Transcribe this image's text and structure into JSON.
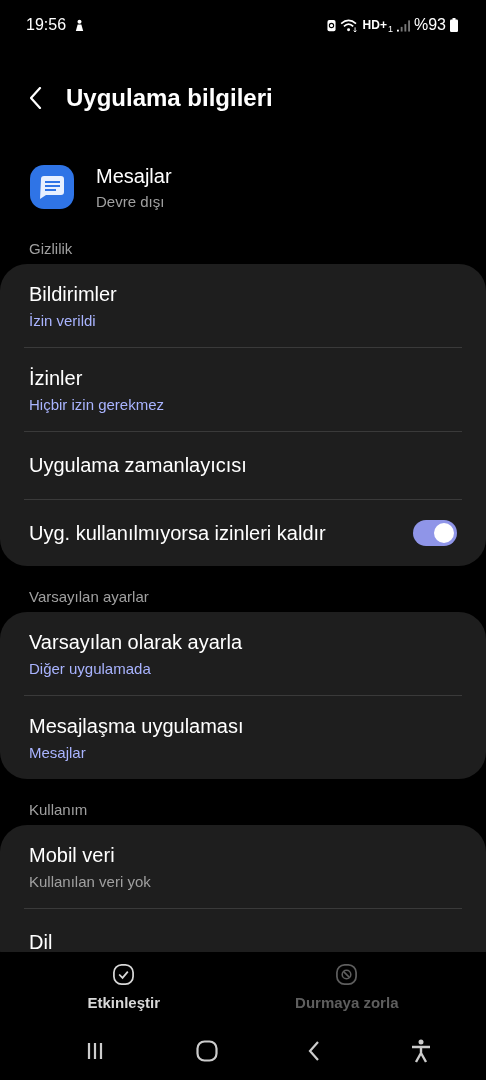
{
  "status_bar": {
    "time": "19:56",
    "network_label": "HD+",
    "sim_label": "1",
    "battery": "%93"
  },
  "header": {
    "title": "Uygulama bilgileri"
  },
  "app": {
    "name": "Mesajlar",
    "status": "Devre dışı"
  },
  "sections": [
    {
      "label": "Gizlilik",
      "items": [
        {
          "kind": "link",
          "title": "Bildirimler",
          "subtitle": "İzin verildi",
          "accent": true
        },
        {
          "kind": "link",
          "title": "İzinler",
          "subtitle": "Hiçbir izin gerekmez",
          "accent": true
        },
        {
          "kind": "link",
          "title": "Uygulama zamanlayıcısı"
        },
        {
          "kind": "toggle",
          "title": "Uyg. kullanılmıyorsa izinleri kaldır",
          "on": true
        }
      ]
    },
    {
      "label": "Varsayılan ayarlar",
      "items": [
        {
          "kind": "link",
          "title": "Varsayılan olarak ayarla",
          "subtitle": "Diğer uygulamada",
          "accent": true
        },
        {
          "kind": "link",
          "title": "Mesajlaşma uygulaması",
          "subtitle": "Mesajlar",
          "accent": true
        }
      ]
    },
    {
      "label": "Kullanım",
      "items": [
        {
          "kind": "link",
          "title": "Mobil veri",
          "subtitle": "Kullanılan veri yok",
          "accent": false
        },
        {
          "kind": "link",
          "title": "Dil"
        }
      ]
    }
  ],
  "actions": [
    {
      "kind": "enable",
      "label": "Etkinleştir",
      "disabled": false
    },
    {
      "kind": "force_stop",
      "label": "Durmaya zorla",
      "disabled": true
    }
  ]
}
